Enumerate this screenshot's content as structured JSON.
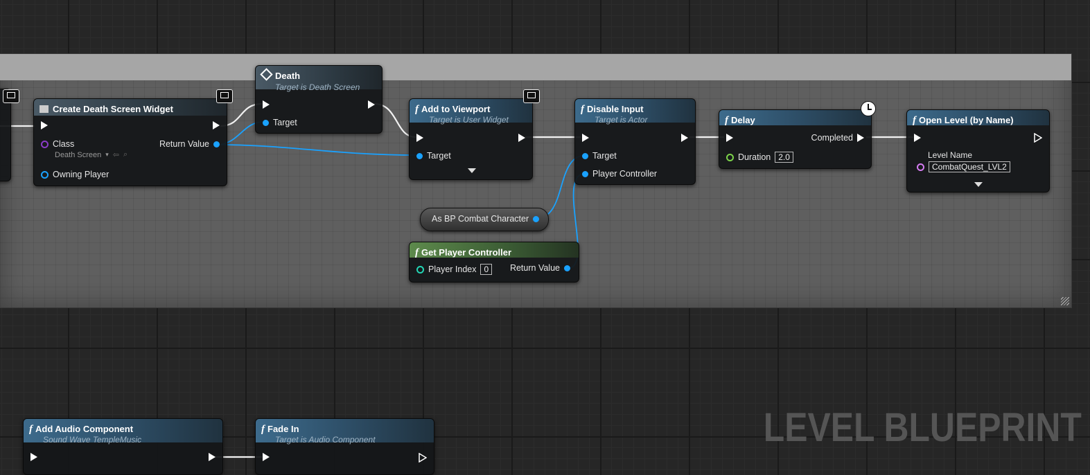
{
  "nodes": {
    "create_widget": {
      "title": "Create Death Screen Widget",
      "class_label": "Class",
      "class_value": "Death Screen",
      "owning_player": "Owning Player",
      "return_value": "Return Value"
    },
    "death": {
      "title": "Death",
      "subtitle": "Target is Death Screen",
      "target": "Target"
    },
    "add_to_viewport": {
      "title": "Add to Viewport",
      "subtitle": "Target is User Widget",
      "target": "Target"
    },
    "disable_input": {
      "title": "Disable Input",
      "subtitle": "Target is Actor",
      "target": "Target",
      "player_controller": "Player Controller"
    },
    "delay": {
      "title": "Delay",
      "completed": "Completed",
      "duration_label": "Duration",
      "duration_value": "2.0"
    },
    "open_level": {
      "title": "Open Level (by Name)",
      "level_name_label": "Level Name",
      "level_name_value": "CombatQuest_LVL2"
    },
    "cast": {
      "label": "As BP Combat Character"
    },
    "get_player_controller": {
      "title": "Get Player Controller",
      "player_index_label": "Player Index",
      "player_index_value": "0",
      "return_value": "Return Value"
    },
    "add_audio": {
      "title": "Add Audio Component",
      "subtitle": "Sound Wave TempleMusic"
    },
    "fade_in": {
      "title": "Fade In",
      "subtitle": "Target is Audio Component"
    }
  },
  "watermark": "LEVEL BLUEPRINT",
  "colors": {
    "exec": "#ffffff",
    "object_pin": "#1aa2ff",
    "class_pin": "#8a3cc8",
    "name_pin": "#d57cf2",
    "float_pin": "#7cd34a",
    "int_pin": "#23d6b5",
    "function_header": "#3d6b8c",
    "pure_header": "#5d8a4c",
    "comment_bar": "#a6a6a6"
  }
}
